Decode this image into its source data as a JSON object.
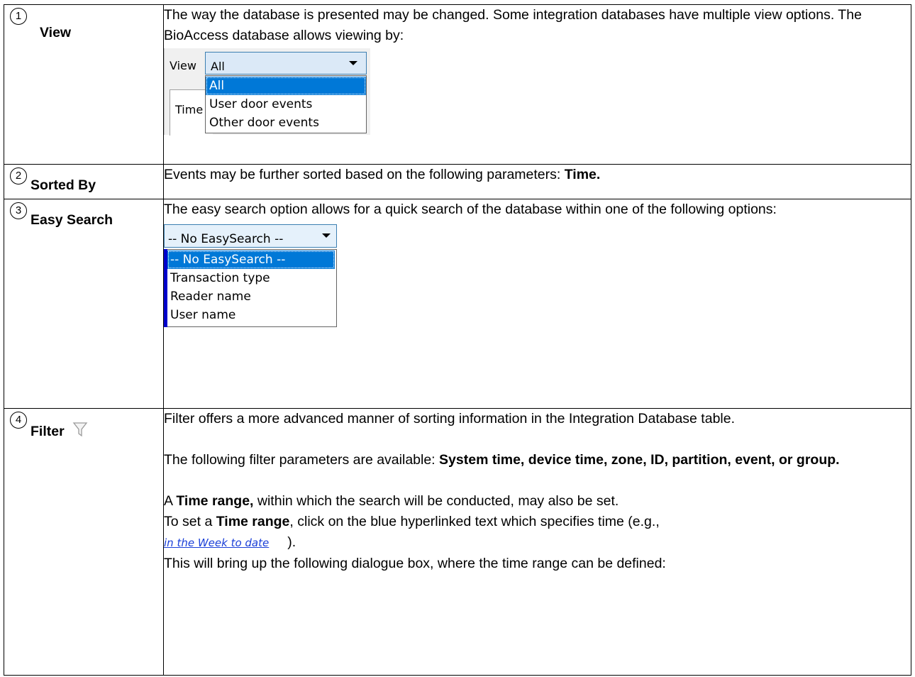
{
  "rows": [
    {
      "number": "1",
      "label": "View",
      "text": "The way the database is presented may be changed. Some integration databases have multiple view options. The BioAccess database allows viewing by:",
      "screenshot": {
        "label": "View",
        "selected": "All",
        "column_header": "Time",
        "options": [
          "All",
          "User door events",
          "Other door events"
        ]
      }
    },
    {
      "number": "2",
      "label": "Sorted By",
      "text_prefix": "Events may be further sorted based on the following parameters: ",
      "text_bold": "Time."
    },
    {
      "number": "3",
      "label": "Easy Search",
      "text": "The easy search option allows for a quick search of the database within one of the following options:",
      "screenshot": {
        "selected": "-- No EasySearch --",
        "options": [
          "-- No EasySearch --",
          "Transaction type",
          "Reader name",
          "User name"
        ]
      }
    },
    {
      "number": "4",
      "label": "Filter",
      "icon": "filter-funnel-icon",
      "para1": "Filter offers a more advanced manner of sorting information in the Integration Database table.",
      "para2_prefix": "The following filter parameters are available: ",
      "para2_bold": "System time, device time, zone, ID, partition, event, or group.",
      "para3_a": "A ",
      "para3_bold": "Time range,",
      "para3_b": " within which the search will be conducted, may also be set.",
      "para4_a": "To set a ",
      "para4_bold": "Time range",
      "para4_b": ", click on the blue hyperlinked text which specifies time (e.g.,",
      "link_text": "in the Week to date",
      "para4_c": ").",
      "para5": "This will bring up the following dialogue box, where the time range can be defined:"
    }
  ],
  "colors": {
    "selection": "#0078d7",
    "link": "#1a3fd8",
    "combo_border": "#3c7fb1"
  }
}
